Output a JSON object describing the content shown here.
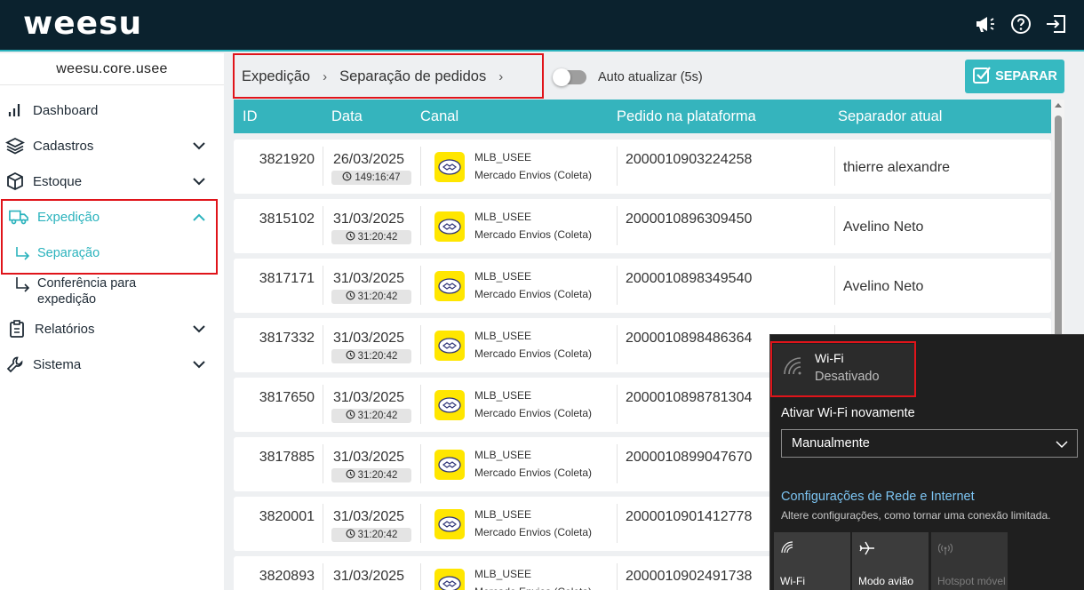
{
  "header": {
    "logo_text": "weesu",
    "icons": [
      "announcement-icon",
      "help-icon",
      "logout-icon"
    ]
  },
  "sidebar": {
    "tenant": "weesu.core.usee",
    "items": [
      {
        "label": "Dashboard",
        "icon": "chart-bars-icon"
      },
      {
        "label": "Cadastros",
        "icon": "layers-icon",
        "expandable": true
      },
      {
        "label": "Estoque",
        "icon": "box-icon",
        "expandable": true
      },
      {
        "label": "Expedição",
        "icon": "truck-icon",
        "expandable": true,
        "active": true
      },
      {
        "label": "Relatórios",
        "icon": "clipboard-icon",
        "expandable": true
      },
      {
        "label": "Sistema",
        "icon": "wrench-icon",
        "expandable": true
      }
    ],
    "subitems": [
      {
        "label": "Separação",
        "active": true
      },
      {
        "label": "Conferência para expedição"
      }
    ]
  },
  "toolbar": {
    "breadcrumb": [
      "Expedição",
      "Separação de pedidos"
    ],
    "auto_update_label": "Auto atualizar (5s)",
    "auto_update_on": false,
    "separar_label": "SEPARAR"
  },
  "table": {
    "columns": [
      "ID",
      "Data",
      "Canal",
      "Pedido na plataforma",
      "Separador atual"
    ],
    "rows": [
      {
        "id": "3821920",
        "date": "26/03/2025",
        "timer": "149:16:47",
        "channel": "MLB_USEE",
        "shipping": "Mercado Envios (Coleta)",
        "order": "2000010903224258",
        "separator": "thierre alexandre"
      },
      {
        "id": "3815102",
        "date": "31/03/2025",
        "timer": "31:20:42",
        "channel": "MLB_USEE",
        "shipping": "Mercado Envios (Coleta)",
        "order": "2000010896309450",
        "separator": "Avelino Neto"
      },
      {
        "id": "3817171",
        "date": "31/03/2025",
        "timer": "31:20:42",
        "channel": "MLB_USEE",
        "shipping": "Mercado Envios (Coleta)",
        "order": "2000010898349540",
        "separator": "Avelino Neto"
      },
      {
        "id": "3817332",
        "date": "31/03/2025",
        "timer": "31:20:42",
        "channel": "MLB_USEE",
        "shipping": "Mercado Envios (Coleta)",
        "order": "2000010898486364",
        "separator": ""
      },
      {
        "id": "3817650",
        "date": "31/03/2025",
        "timer": "31:20:42",
        "channel": "MLB_USEE",
        "shipping": "Mercado Envios (Coleta)",
        "order": "2000010898781304",
        "separator": ""
      },
      {
        "id": "3817885",
        "date": "31/03/2025",
        "timer": "31:20:42",
        "channel": "MLB_USEE",
        "shipping": "Mercado Envios (Coleta)",
        "order": "2000010899047670",
        "separator": ""
      },
      {
        "id": "3820001",
        "date": "31/03/2025",
        "timer": "31:20:42",
        "channel": "MLB_USEE",
        "shipping": "Mercado Envios (Coleta)",
        "order": "2000010901412778",
        "separator": ""
      },
      {
        "id": "3820893",
        "date": "31/03/2025",
        "timer": "",
        "channel": "MLB_USEE",
        "shipping": "Mercado Envios (Coleta)",
        "order": "2000010902491738",
        "separator": ""
      }
    ]
  },
  "wifi_panel": {
    "tile_title": "Wi-Fi",
    "tile_status": "Desativado",
    "reactivate_label": "Ativar Wi-Fi novamente",
    "reactivate_value": "Manualmente",
    "settings_link": "Configurações de Rede e Internet",
    "settings_desc": "Altere configurações, como tornar uma conexão limitada.",
    "quick_tiles": [
      {
        "label": "Wi-Fi",
        "icon": "wifi-icon"
      },
      {
        "label": "Modo avião",
        "icon": "airplane-icon"
      },
      {
        "label": "Hotspot móvel",
        "icon": "hotspot-icon",
        "disabled": true
      }
    ]
  },
  "colors": {
    "topbar": "#0b222e",
    "accent": "#35b4bd",
    "highlight_box": "#e0141a",
    "mercado_livre_yellow": "#ffe600",
    "flyout_bg": "#1f1f1f",
    "link_blue": "#7cc4f2"
  }
}
